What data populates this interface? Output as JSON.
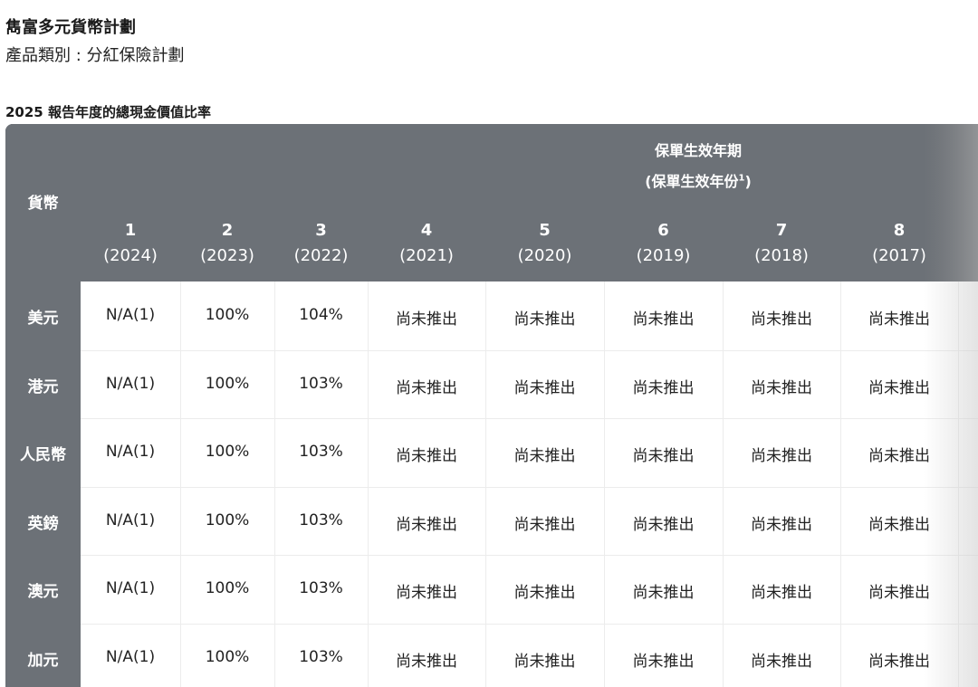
{
  "plan": {
    "name": "雋富多元貨幣計劃",
    "category": "產品類別 : 分紅保險計劃"
  },
  "table": {
    "title": "2025 報告年度的總現金價值比率",
    "currency_header": "貨幣",
    "group_header_line1": "保單生效年期",
    "group_header_line2": "(保單生效年份",
    "group_header_sup": "1",
    "group_header_close": ")",
    "columns": [
      {
        "year": "1",
        "label": "(2024)"
      },
      {
        "year": "2",
        "label": "(2023)"
      },
      {
        "year": "3",
        "label": "(2022)"
      },
      {
        "year": "4",
        "label": "(2021)"
      },
      {
        "year": "5",
        "label": "(2020)"
      },
      {
        "year": "6",
        "label": "(2019)"
      },
      {
        "year": "7",
        "label": "(2018)"
      },
      {
        "year": "8",
        "label": "(2017)"
      }
    ],
    "rows": [
      {
        "currency": "美元",
        "values": [
          "N/A(1)",
          "100%",
          "104%",
          "尚未推出",
          "尚未推出",
          "尚未推出",
          "尚未推出",
          "尚未推出"
        ]
      },
      {
        "currency": "港元",
        "values": [
          "N/A(1)",
          "100%",
          "103%",
          "尚未推出",
          "尚未推出",
          "尚未推出",
          "尚未推出",
          "尚未推出"
        ]
      },
      {
        "currency": "人民幣",
        "values": [
          "N/A(1)",
          "100%",
          "103%",
          "尚未推出",
          "尚未推出",
          "尚未推出",
          "尚未推出",
          "尚未推出"
        ]
      },
      {
        "currency": "英鎊",
        "values": [
          "N/A(1)",
          "100%",
          "103%",
          "尚未推出",
          "尚未推出",
          "尚未推出",
          "尚未推出",
          "尚未推出"
        ]
      },
      {
        "currency": "澳元",
        "values": [
          "N/A(1)",
          "100%",
          "103%",
          "尚未推出",
          "尚未推出",
          "尚未推出",
          "尚未推出",
          "尚未推出"
        ]
      },
      {
        "currency": "加元",
        "values": [
          "N/A(1)",
          "100%",
          "103%",
          "尚未推出",
          "尚未推出",
          "尚未推出",
          "尚未推出",
          "尚未推出"
        ]
      }
    ]
  },
  "colors": {
    "header_bg": "#6c7177",
    "header_text": "#ffffff",
    "cell_bg": "#ffffff",
    "grid_line": "#ececec"
  }
}
